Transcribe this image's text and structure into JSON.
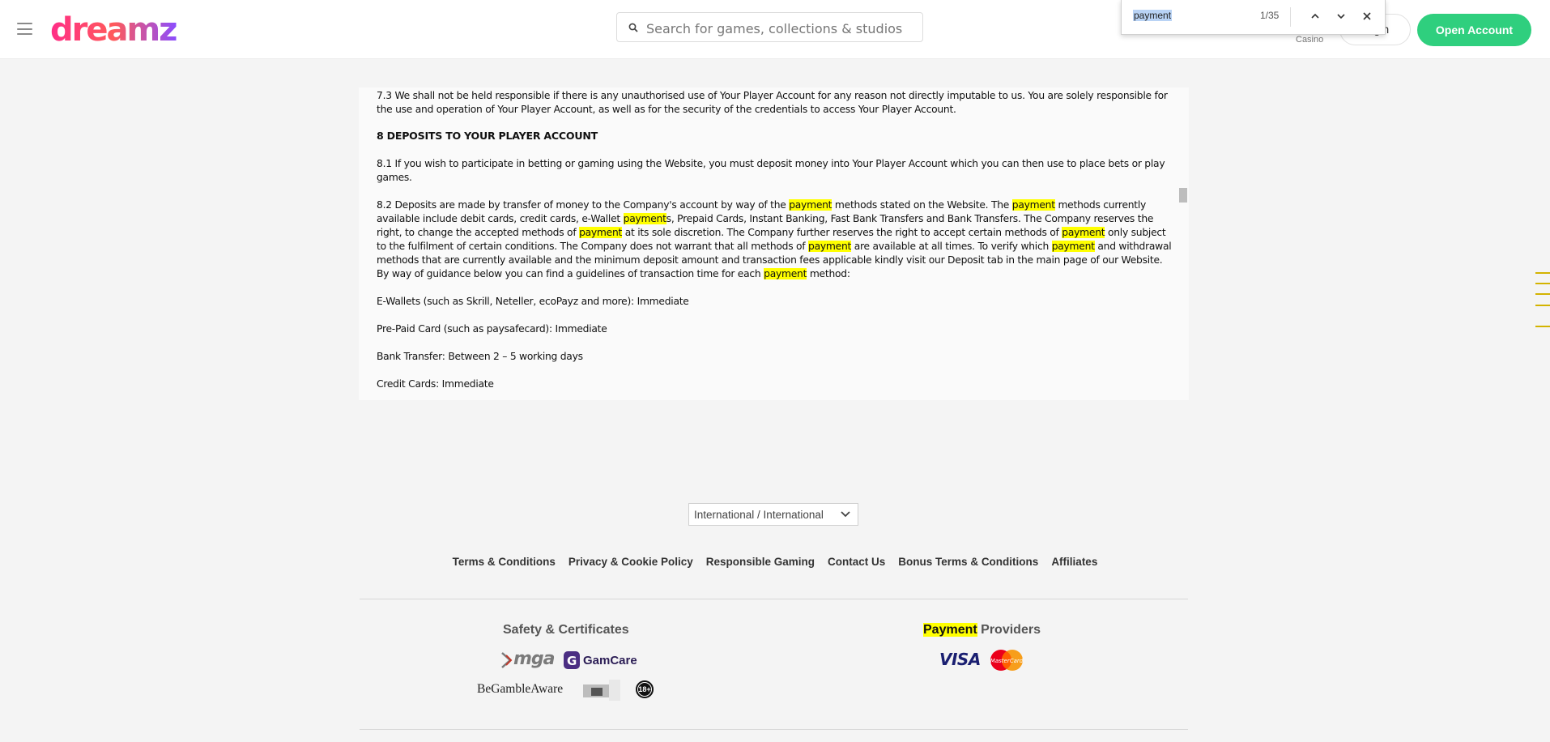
{
  "header": {
    "logo_text": "dreamz",
    "search_placeholder": "Search for games, collections & studios",
    "casino_label": "Casino",
    "login_label": "Login",
    "open_account_label": "Open Account"
  },
  "find_bar": {
    "query": "payment",
    "count": "1/35"
  },
  "document": {
    "p73": "7.3 We shall not be held responsible if there is any unauthorised use of Your Player Account for any reason not directly imputable to us. You are solely responsible for the use and operation of Your Player Account, as well as for the security of the credentials to access Your Player Account.",
    "heading8": "8 DEPOSITS TO YOUR PLAYER ACCOUNT",
    "p81": "8.1 If you wish to participate in betting or gaming using the Website, you must deposit money into Your Player Account which you can then use to place bets or play games.",
    "p82_parts": [
      "8.2 Deposits are made by transfer of money to the Company's account by way of the ",
      "payment",
      " methods stated on the Website. The ",
      "payment",
      " methods currently available include debit cards, credit cards, e-Wallet ",
      "payment",
      "s, Prepaid Cards, Instant Banking, Fast Bank Transfers and Bank Transfers. The Company reserves the right, to change the accepted methods of ",
      "payment",
      " at its sole discretion. The Company further reserves the right to accept certain methods of ",
      "payment",
      " only subject to the fulfilment of certain conditions. The Company does not warrant that all methods of ",
      "payment",
      " are available at all times. To verify which ",
      "payment",
      " and withdrawal methods that are currently available and the minimum deposit amount and transaction fees applicable  kindly visit our Deposit tab in the main page of our Website. By way of guidance below you can find a guidelines of transaction time for each ",
      "payment",
      " method:"
    ],
    "ewallets": "E-Wallets (such as Skrill, Neteller, ecoPayz and more): Immediate",
    "prepaid": "Pre-Paid Card (such as paysafecard): Immediate",
    "bank": "Bank Transfer: Between 2 – 5 working days",
    "credit": "Credit Cards: Immediate"
  },
  "footer": {
    "region": "International / International",
    "links": [
      "Terms & Conditions",
      "Privacy & Cookie Policy",
      "Responsible Gaming",
      "Contact Us",
      "Bonus Terms & Conditions",
      "Affiliates"
    ],
    "safety_title": "Safety & Certificates",
    "payment_title_highlight": "Payment",
    "payment_title_rest": " Providers",
    "mga_label": "mga",
    "gamcare_label": "GamCare",
    "begambleaware_label": "BeGambleAware",
    "age_label": "18+",
    "visa_label": "VISA",
    "mastercard_label": "MasterCard"
  },
  "colors": {
    "accent_green": "#2fcf7e",
    "highlight": "#ffff00",
    "scroll_marker": "#d3b300"
  }
}
